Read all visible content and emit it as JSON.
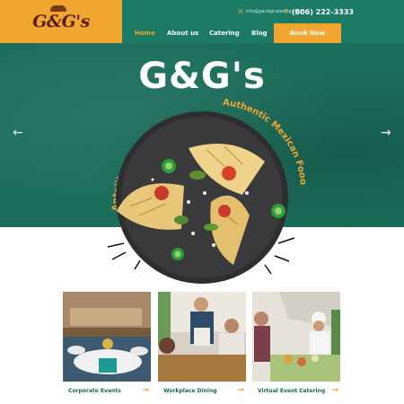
{
  "brand": {
    "logo_text": "G&G's"
  },
  "header": {
    "email": "info@gandgcatering.com",
    "phone": "(806) 222-3333",
    "nav": [
      {
        "label": "Home"
      },
      {
        "label": "About us"
      },
      {
        "label": "Catering"
      },
      {
        "label": "Blog"
      }
    ],
    "book_label": "Book Now"
  },
  "hero": {
    "title": "G&G's",
    "arc_left": "Antojitos Estilo Guadalajara",
    "arc_right": "Authentic Mexican Food",
    "prev_icon": "chevron-left-icon",
    "next_icon": "chevron-right-icon"
  },
  "services": [
    {
      "label": "Corporate Events"
    },
    {
      "label": "Workplace Dining"
    },
    {
      "label": "Virtual Event Catering"
    }
  ],
  "colors": {
    "brand_green": "#1a7a64",
    "accent_orange": "#f2a52f",
    "logo_brown": "#5a1e12"
  }
}
